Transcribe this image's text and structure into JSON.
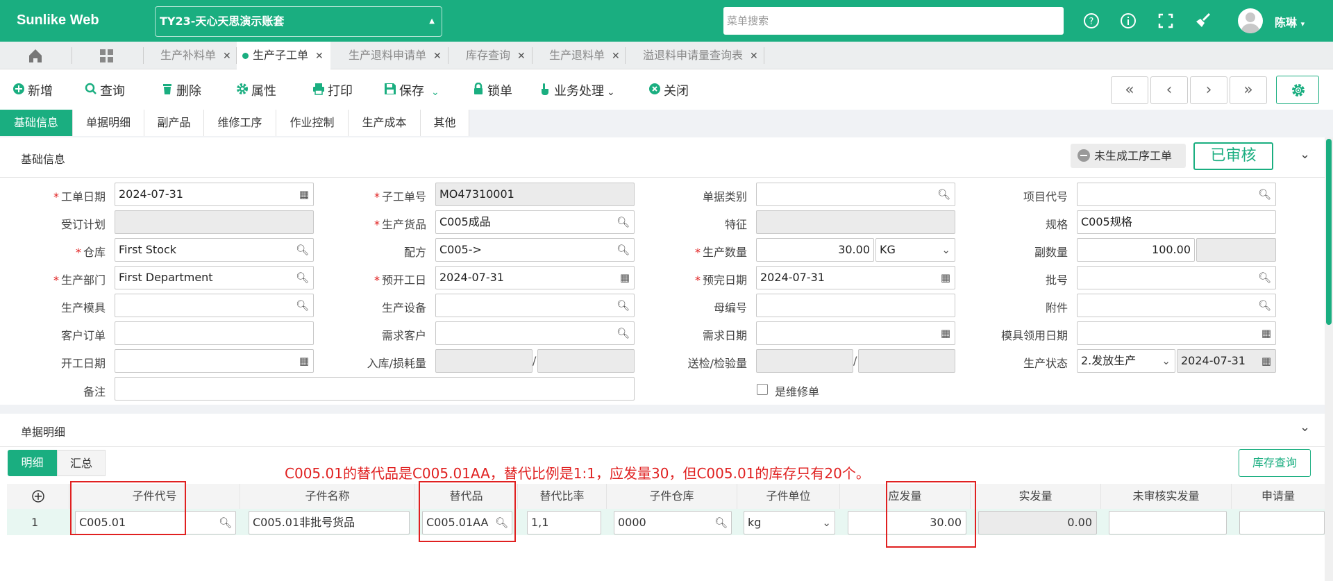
{
  "app": {
    "logo": "Sunlike Web",
    "account": "TY23-天心天思演示账套",
    "search_placeholder": "菜单搜索",
    "user": "陈琳"
  },
  "tabs": [
    "生产补料单",
    "生产子工单",
    "生产退料申请单",
    "库存查询",
    "生产退料单",
    "溢退料申请量查询表"
  ],
  "toolbar": {
    "add": "新增",
    "query": "查询",
    "delete": "删除",
    "props": "属性",
    "print": "打印",
    "save": "保存",
    "lock": "锁单",
    "business": "业务处理",
    "close": "关闭"
  },
  "form_tabs": [
    "基础信息",
    "单据明细",
    "副产品",
    "维修工序",
    "作业控制",
    "生产成本",
    "其他"
  ],
  "section": {
    "basic": "基础信息",
    "status_badge": "未生成工序工单",
    "approved": "已审核",
    "detail": "单据明细"
  },
  "fields": {
    "work_date": {
      "label": "工单日期",
      "value": "2024-07-31"
    },
    "sub_no": {
      "label": "子工单号",
      "value": "MO47310001"
    },
    "doc_type": {
      "label": "单据类别",
      "value": ""
    },
    "project": {
      "label": "项目代号",
      "value": ""
    },
    "order_plan": {
      "label": "受订计划",
      "value": ""
    },
    "product": {
      "label": "生产货品",
      "value": "C005成品"
    },
    "feature": {
      "label": "特征",
      "value": ""
    },
    "spec": {
      "label": "规格",
      "value": "C005规格"
    },
    "warehouse": {
      "label": "仓库",
      "value": "First Stock"
    },
    "formula": {
      "label": "配方",
      "value": "C005->"
    },
    "qty": {
      "label": "生产数量",
      "value": "30.00",
      "unit": "KG"
    },
    "sub_qty": {
      "label": "副数量",
      "value": "100.00"
    },
    "dept": {
      "label": "生产部门",
      "value": "First Department"
    },
    "pre_start": {
      "label": "预开工日",
      "value": "2024-07-31"
    },
    "pre_end": {
      "label": "预完日期",
      "value": "2024-07-31"
    },
    "batch": {
      "label": "批号",
      "value": ""
    },
    "mold": {
      "label": "生产模具",
      "value": ""
    },
    "equipment": {
      "label": "生产设备",
      "value": ""
    },
    "parent_no": {
      "label": "母编号",
      "value": ""
    },
    "attachment": {
      "label": "附件",
      "value": ""
    },
    "cust_order": {
      "label": "客户订单",
      "value": ""
    },
    "req_cust": {
      "label": "需求客户",
      "value": ""
    },
    "req_date": {
      "label": "需求日期",
      "value": ""
    },
    "mold_date": {
      "label": "模具领用日期",
      "value": ""
    },
    "start_date": {
      "label": "开工日期",
      "value": ""
    },
    "in_loss": {
      "label": "入库/损耗量",
      "value": ""
    },
    "send_check": {
      "label": "送检/检验量",
      "value": ""
    },
    "prod_status": {
      "label": "生产状态",
      "value": "2.发放生产",
      "date": "2024-07-31"
    },
    "remark": {
      "label": "备注",
      "value": ""
    },
    "repair": {
      "label": "是维修单"
    }
  },
  "detail": {
    "subtabs": [
      "明细",
      "汇总"
    ],
    "stock_button": "库存查询",
    "annotation": "C005.01的替代品是C005.01AA，替代比例是1:1，应发量30，但C005.01的库存只有20个。",
    "columns": [
      "子件代号",
      "子件名称",
      "替代品",
      "替代比率",
      "子件仓库",
      "子件单位",
      "应发量",
      "实发量",
      "未审核实发量",
      "申请量"
    ],
    "rows": [
      {
        "no": "1",
        "code": "C005.01",
        "name": "C005.01非批号货品",
        "sub": "C005.01AA",
        "ratio": "1,1",
        "wh": "0000",
        "unit": "kg",
        "plan": "30.00",
        "actual": "0.00",
        "unapproved": "",
        "apply": ""
      }
    ]
  },
  "colors": {
    "accent": "#1aae80",
    "annotation": "#e02020"
  }
}
